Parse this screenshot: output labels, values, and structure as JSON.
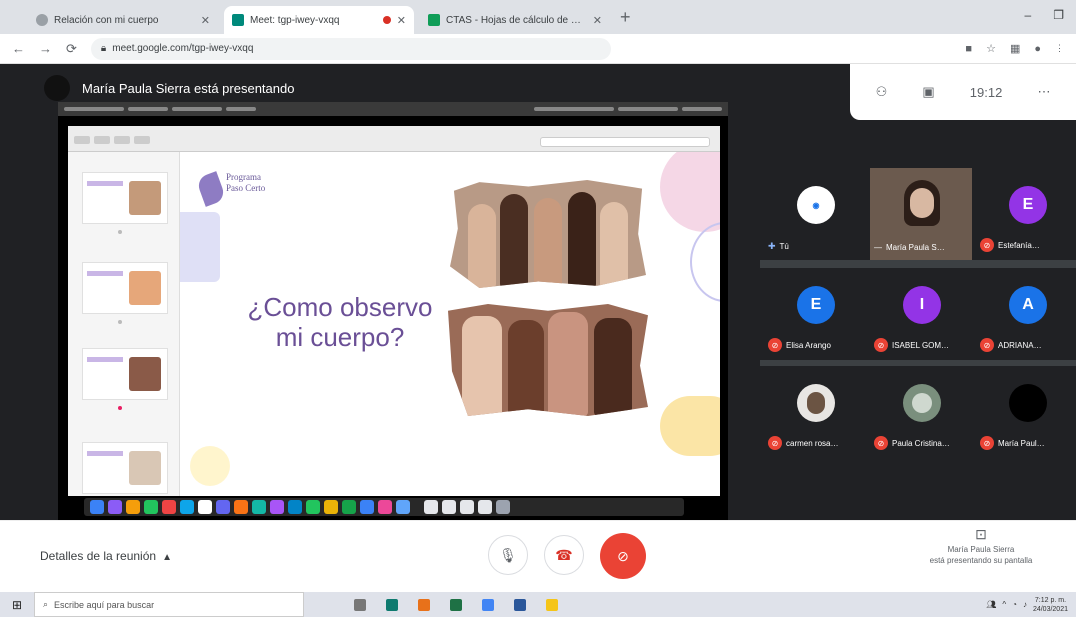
{
  "browser": {
    "tabs": [
      {
        "label": "Relación con mi cuerpo",
        "favicon_color": "#5f6368",
        "active": false,
        "recording": false
      },
      {
        "label": "Meet: tgp-iwey-vxqq",
        "favicon_color": "#00897b",
        "active": true,
        "recording": true
      },
      {
        "label": "CTAS - Hojas de cálculo de Go…",
        "favicon_color": "#0f9d58",
        "active": false,
        "recording": false
      }
    ],
    "new_tab": "+",
    "url": "meet.google.com/tgp-iwey-vxqq",
    "window_controls": [
      "–",
      "❐"
    ]
  },
  "meet": {
    "presenter_banner": "María Paula Sierra está presentando",
    "clock": "19:12",
    "slide": {
      "heading_line1": "¿Como observo",
      "heading_line2": "mi cuerpo?",
      "logo_line1": "Programa",
      "logo_line2": "Paso Certo"
    },
    "participants": [
      {
        "name": "Tú",
        "initial": "",
        "avatar_color": "#ffffff",
        "muted": false,
        "kind": "logo"
      },
      {
        "name": "María Paula S…",
        "initial": "",
        "avatar_color": "#6b5a4e",
        "muted": false,
        "kind": "video"
      },
      {
        "name": "Estefanía…",
        "initial": "E",
        "avatar_color": "#9334e6",
        "muted": true,
        "kind": "initial"
      },
      {
        "name": "Elisa Arango",
        "initial": "E",
        "avatar_color": "#1a73e8",
        "muted": true,
        "kind": "initial"
      },
      {
        "name": "ISABEL GOM…",
        "initial": "I",
        "avatar_color": "#9334e6",
        "muted": true,
        "kind": "initial"
      },
      {
        "name": "ADRIANA…",
        "initial": "A",
        "avatar_color": "#1a73e8",
        "muted": true,
        "kind": "initial"
      },
      {
        "name": "carmen rosa…",
        "initial": "",
        "avatar_color": "#e8e6e3",
        "muted": true,
        "kind": "photo"
      },
      {
        "name": "Paula Cristina…",
        "initial": "",
        "avatar_color": "#7a8f7d",
        "muted": true,
        "kind": "photo"
      },
      {
        "name": "María Paul…",
        "initial": "",
        "avatar_color": "#000000",
        "muted": true,
        "kind": "photo"
      }
    ],
    "bottom": {
      "details_label": "Detalles de la reunión",
      "present_line1": "María Paula Sierra",
      "present_line2": "está presentando su pantalla"
    }
  },
  "taskbar": {
    "search_placeholder": "Escribe aquí para buscar",
    "time": "7:12 p. m.",
    "date": "24/03/2021"
  },
  "colors": {
    "meet_bg": "#202124",
    "hangup_red": "#ea4335",
    "slide_heading": "#6a4f96"
  }
}
